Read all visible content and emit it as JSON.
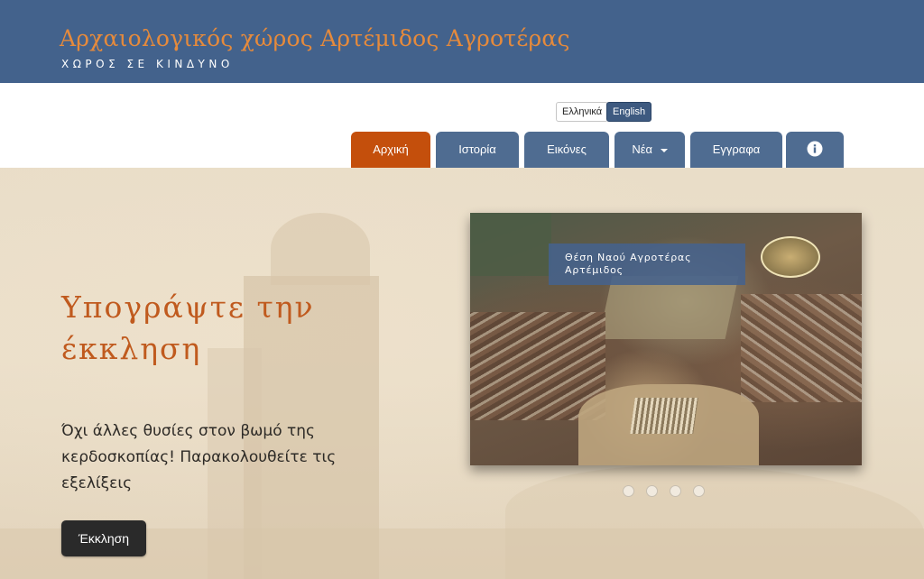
{
  "header": {
    "title": "Αρχαιολογικός χώρος Αρτέμιδος Αγροτέρας",
    "subtitle": "ΧΩΡΟΣ ΣΕ ΚΙΝΔΥΝΟ"
  },
  "languages": {
    "greek": "Ελληνικά",
    "english": "English",
    "selected": "English"
  },
  "nav": {
    "items": [
      {
        "label": "Αρχική",
        "active": true
      },
      {
        "label": "Ιστορία",
        "active": false
      },
      {
        "label": "Εικόνες",
        "active": false
      },
      {
        "label": "Νέα",
        "active": false,
        "has_dropdown": true
      },
      {
        "label": "Εγγραφα",
        "active": false
      },
      {
        "label": "",
        "icon": "info-icon",
        "active": false
      }
    ]
  },
  "hero": {
    "title": "Υπογράψτε την έκκληση",
    "text": "Όχι άλλες θυσίες στον βωμό της κερδοσκοπίας! Παρακολουθείτε τις εξελίξεις",
    "button_label": "Έκκληση"
  },
  "carousel": {
    "caption": "Θέση Ναού Αγροτέρας Αρτέμιδος",
    "slide_count": 4,
    "active_slide": 1
  },
  "colors": {
    "header_bg": "#43628c",
    "title_orange": "#e58a3c",
    "nav_tab": "#4f6c91",
    "nav_active": "#c44f0c",
    "hero_title": "#c05a1e",
    "button_dark": "#2a2a2a"
  }
}
